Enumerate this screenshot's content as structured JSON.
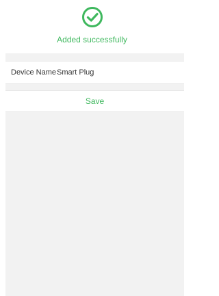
{
  "success": {
    "icon": "checkmark-circle-icon",
    "message": "Added successfully"
  },
  "device": {
    "label": "Device Name",
    "value": "Smart Plug"
  },
  "actions": {
    "save_label": "Save"
  },
  "colors": {
    "accent": "#3fb85e",
    "background": "#f2f2f2",
    "text": "#333333"
  }
}
